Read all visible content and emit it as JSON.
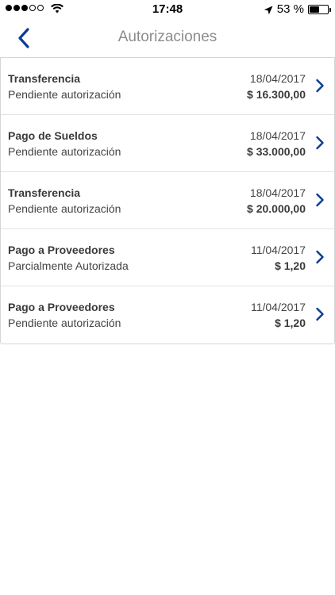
{
  "status_bar": {
    "time": "17:48",
    "battery_percent": "53 %",
    "battery_level": 0.53,
    "signal_bars_filled": 3,
    "signal_bars_total": 5
  },
  "nav": {
    "title": "Autorizaciones",
    "back_icon": "chevron-left-icon"
  },
  "colors": {
    "accent": "#0a3d91",
    "title_gray": "#8c8c8c"
  },
  "authorizations": [
    {
      "type": "Transferencia",
      "status": "Pendiente autorización",
      "date": "18/04/2017",
      "amount": "$ 16.300,00"
    },
    {
      "type": "Pago de Sueldos",
      "status": "Pendiente autorización",
      "date": "18/04/2017",
      "amount": "$ 33.000,00"
    },
    {
      "type": "Transferencia",
      "status": "Pendiente autorización",
      "date": "18/04/2017",
      "amount": "$ 20.000,00"
    },
    {
      "type": "Pago a Proveedores",
      "status": "Parcialmente Autorizada",
      "date": "11/04/2017",
      "amount": "$ 1,20"
    },
    {
      "type": "Pago a Proveedores",
      "status": "Pendiente autorización",
      "date": "11/04/2017",
      "amount": "$ 1,20"
    }
  ]
}
